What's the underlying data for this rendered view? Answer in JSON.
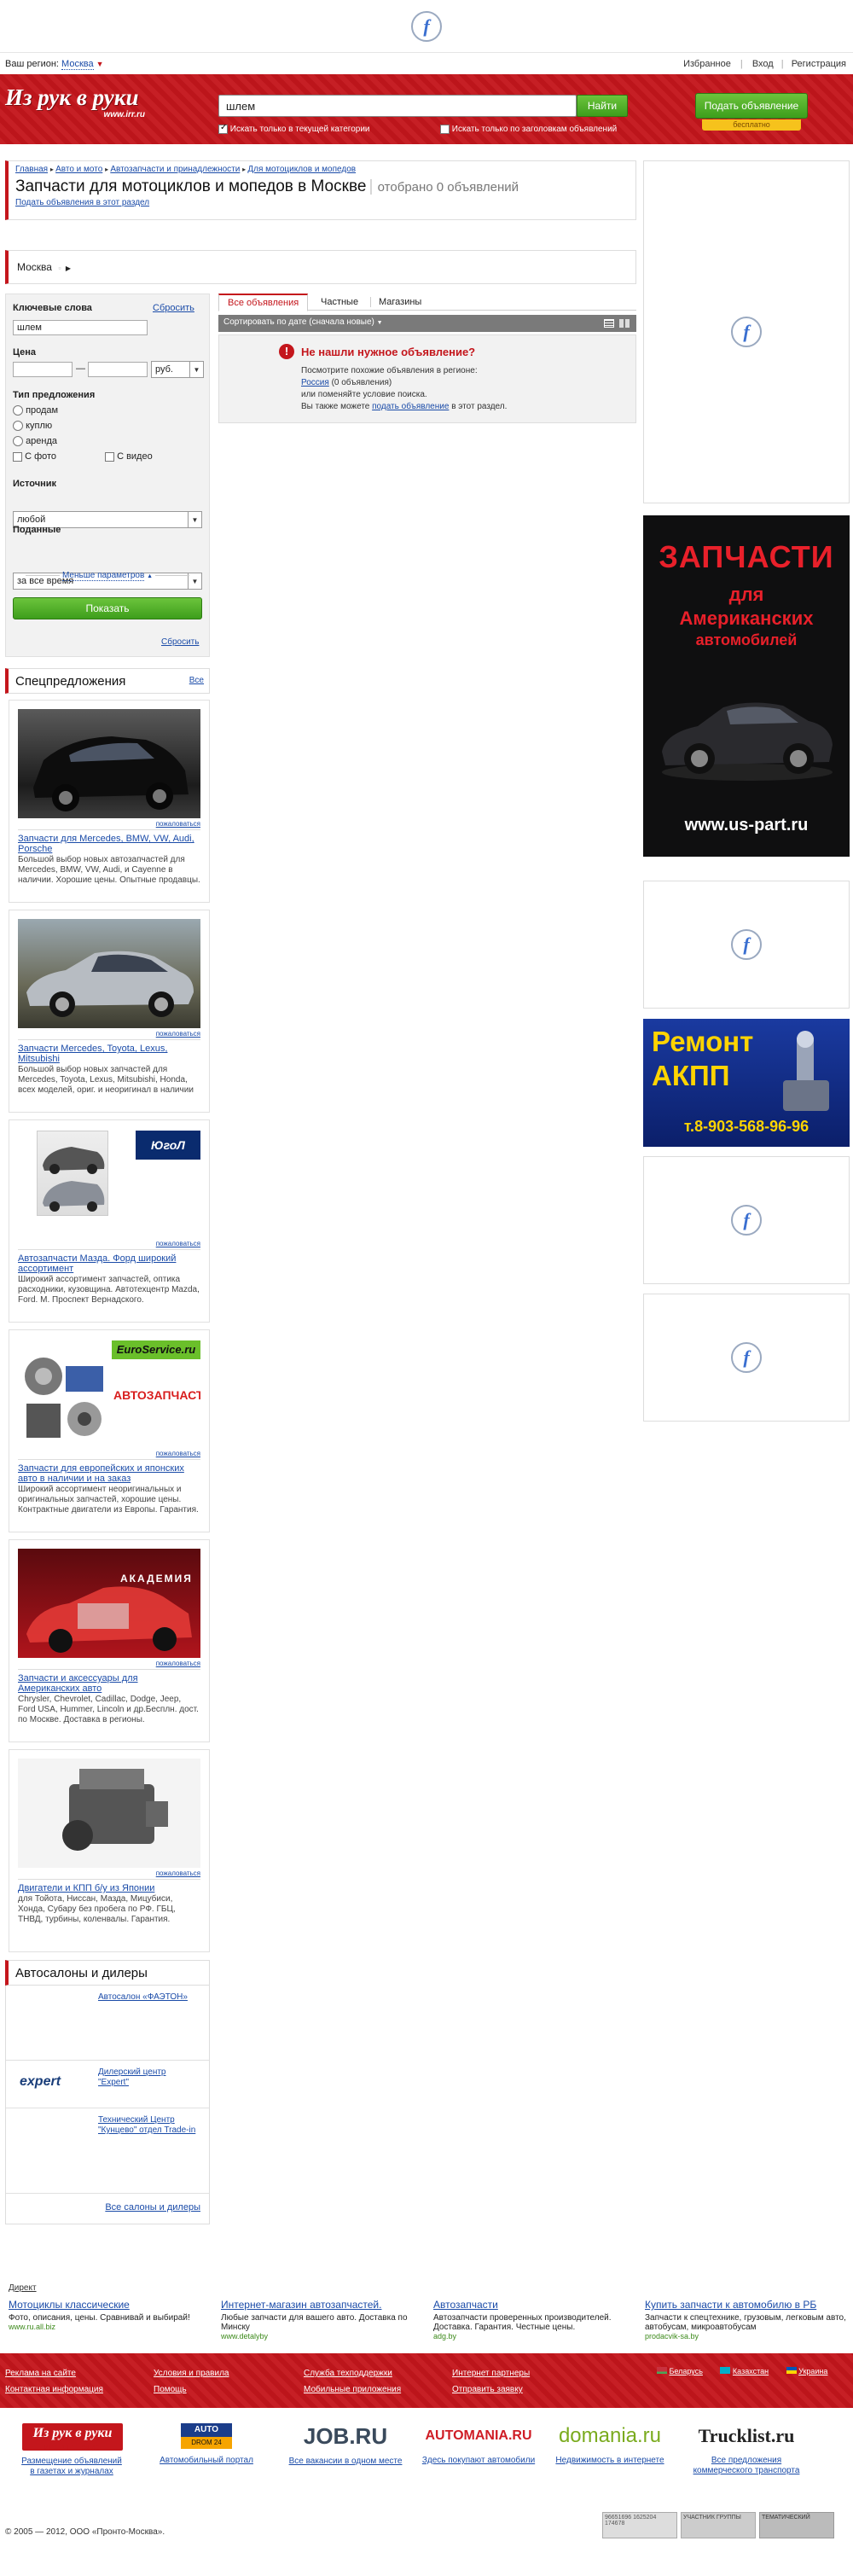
{
  "region": {
    "label": "Ваш регион:",
    "city": "Москва"
  },
  "topnav": {
    "favorites": "Избранное",
    "login": "Вход",
    "register": "Регистрация"
  },
  "header": {
    "logo_text": "Из рук в руки",
    "logo_url": "www.irr.ru",
    "search_value": "шлем",
    "search_button": "Найти",
    "only_current_category": "Искать только в текущей категории",
    "only_titles": "Искать только по заголовкам объявлений",
    "post_ad_button": "Подать объявление",
    "free_label": "бесплатно"
  },
  "breadcrumb": [
    "Главная",
    "Авто и мото",
    "Автозапчасти и принадлежности",
    "Для мотоциклов и мопедов"
  ],
  "page": {
    "title": "Запчасти для мотоциклов и мопедов в Москве",
    "count": "отобрано 0 объявлений",
    "post_here_link": "Подать объявления в этот раздел"
  },
  "location_bar": {
    "city": "Москва"
  },
  "filters": {
    "keywords_label": "Ключевые слова",
    "reset_label": "Сбросить",
    "keywords_value": "шлем",
    "price_label": "Цена",
    "price_dash": "—",
    "currency": "руб.",
    "offer_type_label": "Тип предложения",
    "offer_types": [
      "продам",
      "куплю",
      "аренда"
    ],
    "with_photo": "С фото",
    "with_video": "С видео",
    "source_label": "Источник",
    "source_value": "любой",
    "submitted_label": "Поданные",
    "submitted_value": "за все время",
    "fewer_params": "Меньше параметров",
    "show_button": "Показать",
    "reset_bottom": "Сбросить"
  },
  "tabs": [
    "Все объявления",
    "Частные",
    "Магазины"
  ],
  "sort": {
    "label": "Сортировать по дате (сначала новые)"
  },
  "notfound": {
    "title": "Не нашли нужное объявление?",
    "line1": "Посмотрите похожие объявления в регионе:",
    "region_link": "Россия",
    "region_count": "(0 объявления)",
    "line3": "или поменяйте условие поиска.",
    "line4_pre": "Вы также можете",
    "line4_link": "подать объявление",
    "line4_post": "в этот раздел."
  },
  "special": {
    "title": "Спецпредложения",
    "all_link": "Все",
    "report_label": "пожаловаться",
    "items": [
      {
        "title": "Запчасти для Mercedes, BMW, VW, Audi, Porsche",
        "text": "Большой выбор новых автозапчастей для Mercedes, BMW, VW, Audi, и Cayenne в наличии. Хорошие цены. Опытные продавцы."
      },
      {
        "title": "Запчасти Mercedes, Toyota, Lexus, Mitsubishi",
        "text": "Большой выбор новых запчастей для Mercedes, Toyota, Lexus, Mitsubishi, Honda, всех моделей, ориг. и неоригинал в наличии"
      },
      {
        "title": "Автозапчасти Мазда. Форд широкий ассортимент",
        "text": "Широкий ассортимент запчастей, оптика расходники, кузовщина. Автотехцентр Mazda, Ford. М. Проспект Вернадского."
      },
      {
        "title": "Запчасти для европейских и японских авто в наличии и на заказ",
        "text": "Широкий ассортимент неоригинальных и оригинальных запчастей, хорошие цены. Контрактные двигатели из Европы. Гарантия."
      },
      {
        "title": "Запчасти и аксессуары для Американских авто",
        "text": "Chrysler, Chevrolet, Cadillac, Dodge, Jeep, Ford USA, Hummer, Lincoln и др.Бесплн. дост. по Москве. Доставка в регионы."
      },
      {
        "title": "Двигатели и КПП б/у из Японии",
        "text": "для Тойота, Ниссан, Мазда, Мицубиси, Хонда, Субару без пробега по РФ. ГБЦ, ТНВД, турбины, коленвалы. Гарантия."
      }
    ],
    "img_texts": {
      "logo3": "ЮгоЛ",
      "brand4": "EuroService.ru",
      "parts4": "АВТОЗАПЧАСТИ",
      "brand5": "АКАДЕМИЯ"
    }
  },
  "dealers": {
    "title": "Автосалоны и дилеры",
    "items": [
      "Автосалон «ФАЭТОН»",
      "Дилерский центр \"Expert\"",
      "Технический Центр \"Кунцево\" отдел Trade-in"
    ],
    "expert_logo": "expert",
    "all_link": "Все салоны и дилеры"
  },
  "banners": {
    "usparts": {
      "line1": "ЗАПЧАСТИ",
      "line2": "для",
      "line3": "Американских",
      "line4": "автомобилей",
      "url": "www.us-part.ru"
    },
    "akpp": {
      "line1": "Ремонт",
      "line2": "АКПП",
      "phone": "т.8-903-568-96-96"
    }
  },
  "direct": {
    "label": "Директ",
    "ads": [
      {
        "title": "Мотоциклы классические",
        "text": "Фото, описания, цены. Сравнивай и выбирай!",
        "url": "www.ru.all.biz"
      },
      {
        "title": "Интернет-магазин автозапчастей.",
        "text": "Любые запчасти для вашего авто. Доставка по Минску",
        "url": "www.detalyby"
      },
      {
        "title": "Автозапчасти",
        "text": "Автозапчасти проверенных производителей. Доставка. Гарантия. Честные цены.",
        "url": "adg.by"
      },
      {
        "title": "Купить запчасти к автомобилю в РБ",
        "text": "Запчасти к спецтехнике, грузовым, легковым авто, автобусам, микроавтобусам",
        "url": "prodacvik-sa.by"
      }
    ]
  },
  "footer": {
    "col1": [
      "Реклама на сайте",
      "Контактная информация"
    ],
    "col2": [
      "Условия и правила",
      "Помощь"
    ],
    "col3": [
      "Служба техподдержки",
      "Мобильные приложения"
    ],
    "col4": [
      "Интернет партнеры",
      "Отправить заявку"
    ],
    "langs": [
      "Беларусь",
      "Казахстан",
      "Украина"
    ]
  },
  "partners": [
    {
      "logo": "Из рук в руки",
      "sub": "ИНТЕРНЕТ - ОФИС",
      "caption": "Размещение объявлений в газетах и журналах"
    },
    {
      "logo": "AUTO",
      "sub": "DROM 24",
      "caption": "Автомобильный портал"
    },
    {
      "logo": "JOB.RU",
      "caption": "Все вакансии в одном месте"
    },
    {
      "logo": "AUTOMANIA.RU",
      "caption": "Здесь покупают автомобили"
    },
    {
      "logo": "domania.ru",
      "caption": "Недвижимость в интернете"
    },
    {
      "logo": "Trucklist.ru",
      "caption": "Все предложения коммерческого транспорта"
    }
  ],
  "copyright": "© 2005 — 2012, ООО «Пронто-Москва».",
  "counters": [
    "96651696 1625204 174678",
    "УЧАСТНИК ГРУППЫ",
    "ТЕМАТИЧЕСКИЙ"
  ],
  "colors": {
    "brand_red": "#c4161c",
    "link": "#1a4ba8",
    "green": "#3d9e1c"
  }
}
